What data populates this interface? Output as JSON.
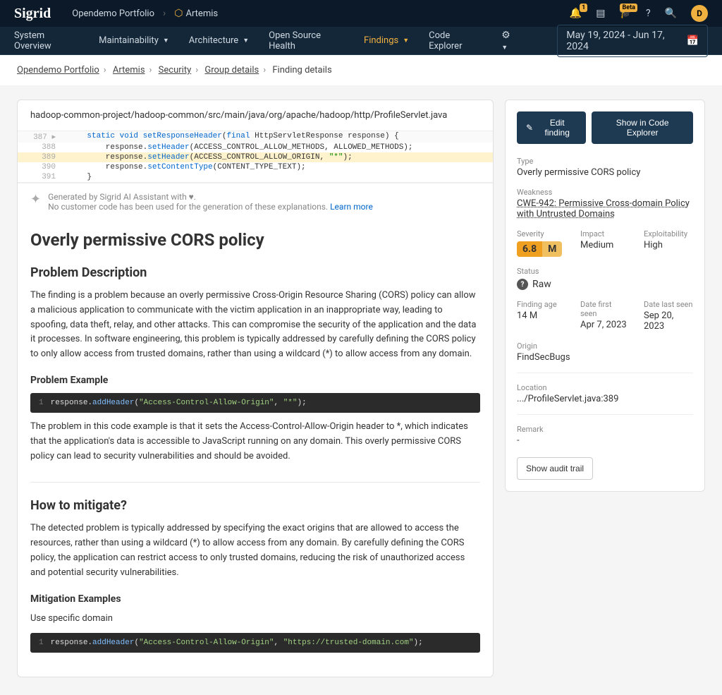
{
  "header": {
    "logo": "Sigrid",
    "portfolio": "Opendemo Portfolio",
    "project": "Artemis",
    "badges": {
      "bell": "1",
      "hat": "Beta",
      "user": "D"
    }
  },
  "menu": {
    "items": [
      "System Overview",
      "Maintainability",
      "Architecture",
      "Open Source Health",
      "Findings",
      "Code Explorer"
    ],
    "date_range": "May 19, 2024 - Jun 17, 2024"
  },
  "breadcrumbs": {
    "items": [
      "Opendemo Portfolio",
      "Artemis",
      "Security",
      "Group details",
      "Finding details"
    ]
  },
  "file_path": "hadoop-common-project/hadoop-common/src/main/java/org/apache/hadoop/http/ProfileServlet.java",
  "code": {
    "lines": [
      {
        "num": "387",
        "fold": true,
        "tokens": [
          [
            "    ",
            "plain"
          ],
          [
            "static void ",
            "kw"
          ],
          [
            "setResponseHeader",
            "method"
          ],
          [
            "(",
            "plain"
          ],
          [
            "final ",
            "kw"
          ],
          [
            "HttpServletResponse response) {",
            "plain"
          ]
        ]
      },
      {
        "num": "388",
        "tokens": [
          [
            "        response.",
            "plain"
          ],
          [
            "setHeader",
            "method"
          ],
          [
            "(ACCESS_CONTROL_ALLOW_METHODS, ALLOWED_METHODS);",
            "plain"
          ]
        ]
      },
      {
        "num": "389",
        "highlighted": true,
        "tokens": [
          [
            "        response.",
            "plain"
          ],
          [
            "setHeader",
            "method"
          ],
          [
            "(ACCESS_CONTROL_ALLOW_ORIGIN, ",
            "plain"
          ],
          [
            "\"*\"",
            "str"
          ],
          [
            ");",
            "plain"
          ]
        ]
      },
      {
        "num": "390",
        "tokens": [
          [
            "        response.",
            "plain"
          ],
          [
            "setContentType",
            "method"
          ],
          [
            "(CONTENT_TYPE_TEXT);",
            "plain"
          ]
        ]
      },
      {
        "num": "391",
        "tokens": [
          [
            "    }",
            "plain"
          ]
        ]
      }
    ]
  },
  "ai": {
    "line1": "Generated by Sigrid AI Assistant with ♥.",
    "line2": "No customer code has been used for the generation of these explanations.",
    "learn_more": "Learn more"
  },
  "article": {
    "title": "Overly permissive CORS policy",
    "problem_desc_h": "Problem Description",
    "problem_desc": "The finding is a problem because an overly permissive Cross-Origin Resource Sharing (CORS) policy can allow a malicious application to communicate with the victim application in an inappropriate way, leading to spoofing, data theft, relay, and other attacks. This can compromise the security of the application and the data it processes. In software engineering, this problem is typically addressed by carefully defining the CORS policy to only allow access from trusted domains, rather than using a wildcard (*) to allow access from any domain.",
    "problem_ex_h": "Problem Example",
    "code_ex1": {
      "ln": "1",
      "prefix": "response.",
      "method": "addHeader",
      "paren": "(",
      "str1": "\"Access-Control-Allow-Origin\"",
      "comma": ", ",
      "str2": "\"*\"",
      "close": ");"
    },
    "problem_ex_p": "The problem in this code example is that it sets the Access-Control-Allow-Origin header to *, which indicates that the application's data is accessible to JavaScript running on any domain. This overly permissive CORS policy can lead to security vulnerabilities and should be avoided.",
    "mitigate_h": "How to mitigate?",
    "mitigate_p": "The detected problem is typically addressed by specifying the exact origins that are allowed to access the resources, rather than using a wildcard (*) to allow access from any domain. By carefully defining the CORS policy, the application can restrict access to only trusted domains, reducing the risk of unauthorized access and potential security vulnerabilities.",
    "mitigate_ex_h": "Mitigation Examples",
    "mitigate_specific": "Use specific domain",
    "code_ex2": {
      "ln": "1",
      "prefix": "response.",
      "method": "addHeader",
      "paren": "(",
      "str1": "\"Access-Control-Allow-Origin\"",
      "comma": ", ",
      "str2": "\"https://trusted-domain.com\"",
      "close": ");"
    }
  },
  "side": {
    "edit_btn": "Edit finding",
    "show_btn": "Show in Code Explorer",
    "type_l": "Type",
    "type_v": "Overly permissive CORS policy",
    "weakness_l": "Weakness",
    "weakness_v": "CWE-942: Permissive Cross-domain Policy with Untrusted Domains",
    "severity_l": "Severity",
    "severity_num": "6.8",
    "severity_letter": "M",
    "impact_l": "Impact",
    "impact_v": "Medium",
    "exploit_l": "Exploitability",
    "exploit_v": "High",
    "status_l": "Status",
    "status_v": "Raw",
    "age_l": "Finding age",
    "age_v": "14 M",
    "first_l": "Date first seen",
    "first_v": "Apr 7, 2023",
    "last_l": "Date last seen",
    "last_v": "Sep 20, 2023",
    "origin_l": "Origin",
    "origin_v": "FindSecBugs",
    "location_l": "Location",
    "location_v": ".../ProfileServlet.java:389",
    "remark_l": "Remark",
    "remark_v": "-",
    "audit_btn": "Show audit trail"
  }
}
